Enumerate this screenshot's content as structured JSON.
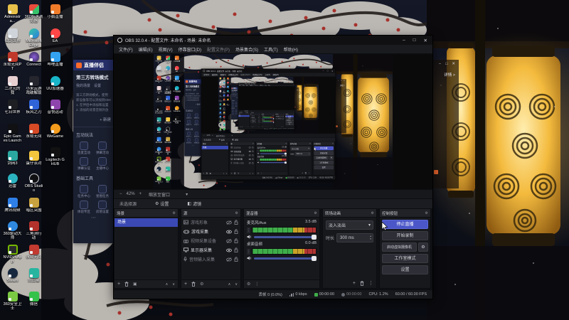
{
  "ui_colors": {
    "accent": "#4b57c8",
    "selection": "#3a49b4",
    "stream_green": "#3fae4a",
    "meter_green": "#3fae4a",
    "meter_yellow": "#c9a227",
    "meter_red": "#b03434",
    "lantern": "#f7c948",
    "companion_header": "#27306b"
  },
  "icons": {
    "gear": "⚙",
    "kebab": "⋮",
    "up": "∧",
    "down": "∨",
    "caret": "▾",
    "plus": "+",
    "minus": "−",
    "spin_up": "▴",
    "spin_down": "▾",
    "grip": "⋮",
    "more": "⋯",
    "filter": "◧",
    "dup": "▣"
  },
  "window_controls": {
    "minimize": "–",
    "maximize": "□",
    "close": "✕"
  },
  "desktop": {
    "icons": [
      {
        "label": "Administra..."
      },
      {
        "label": "仙剑世界"
      },
      {
        "label": "永劫无间PT"
      },
      {
        "label": "二次元的我"
      },
      {
        "label": "七日世界"
      },
      {
        "label": "Epic Games Launcher"
      },
      {
        "label": "剑网3"
      },
      {
        "label": "迅雷"
      },
      {
        "label": "腾讯视频"
      },
      {
        "label": "360驱动大师"
      },
      {
        "label": "NVIDIA App"
      },
      {
        "label": "Steam"
      },
      {
        "label": "360安全卫士"
      },
      {
        "label": "360极速浏览器"
      },
      {
        "label": "Microsoft Edge"
      },
      {
        "label": "Connect"
      },
      {
        "label": "小米云游戏破解版"
      },
      {
        "label": "疾风之刃"
      },
      {
        "label": "永劫无间"
      },
      {
        "label": "蛋仔派对"
      },
      {
        "label": "OBS Studio"
      },
      {
        "label": "暗区突围"
      },
      {
        "label": "三角洲行动"
      },
      {
        "label": "永劫无间"
      },
      {
        "label": "向日葵"
      },
      {
        "label": "微信"
      },
      {
        "label": "小鹅直播"
      },
      {
        "label": "EA"
      },
      {
        "label": "哔哩直播"
      },
      {
        "label": "UU加速器"
      },
      {
        "label": "音悦运动"
      },
      {
        "label": "WeGame"
      },
      {
        "label": "Logitech G HUB"
      }
    ]
  },
  "companion": {
    "logo": "直播伴侣",
    "heading": "第三方转场模式",
    "tabs": "我的场景　设置",
    "desc1": "第三方转场模式，使用",
    "desc2": "新设备等可以添加到OBS",
    "desc3": "1. 在伴侣中添加和设置",
    "desc4": "2. 添加的背景音频外放",
    "new_button": "+ 新建",
    "section_interact": "互动玩法",
    "interact_items": [
      {
        "label": "连麦互动"
      },
      {
        "label": "弹幕活动"
      },
      {
        "label": "弹幕认证"
      },
      {
        "label": "主播中心"
      }
    ],
    "section_tools": "基础工具",
    "tool_items": [
      {
        "label": "任务中心"
      },
      {
        "label": "星图任务"
      },
      {
        "label": "体验专区"
      },
      {
        "label": "房管设置"
      }
    ],
    "more": "⋯",
    "detail_link": "详情 >"
  },
  "obs": {
    "title": "OBS 32.0.4 - 配置文件: 未命名 - 场景: 未命名",
    "menu": [
      {
        "label": "文件(F)"
      },
      {
        "label": "编辑(E)"
      },
      {
        "label": "视图(V)"
      },
      {
        "label": "停靠窗口(D)"
      },
      {
        "label": "配置文件(P)"
      },
      {
        "label": "场景集合(S)"
      },
      {
        "label": "工具(T)"
      },
      {
        "label": "帮助(H)"
      }
    ],
    "zoom": {
      "level": "42%",
      "fit": "缩放至窗口"
    },
    "source_bar": {
      "none_selected": "未选择源",
      "settings": "设置",
      "filters": "滤镜"
    },
    "scenes": {
      "title": "场景",
      "items": [
        {
          "name": "场景"
        }
      ]
    },
    "sources": {
      "title": "源",
      "items": [
        {
          "name": "游戏形象",
          "visible": false
        },
        {
          "name": "游戏采集",
          "visible": true
        },
        {
          "name": "视频采集设备",
          "visible": false
        },
        {
          "name": "显示器采集",
          "visible": true
        },
        {
          "name": "音频输入采集",
          "visible": false
        }
      ]
    },
    "mixer": {
      "title": "混音器",
      "channels": [
        {
          "name": "麦克风/Aux",
          "db": "3.5 dB"
        },
        {
          "name": "桌面音频",
          "db": "0.0 dB"
        }
      ]
    },
    "transitions": {
      "title": "转场动画",
      "selected": "淡入淡出",
      "duration_label": "时长",
      "duration": "300 ms"
    },
    "controls": {
      "title": "控制按钮",
      "stop_stream": "停止直播",
      "start_record": "开始录制",
      "virtual_cam": "启动虚拟摄像机",
      "studio_mode": "工作室模式",
      "settings": "设置"
    },
    "status": {
      "dropped": "丢帧 0 (0.0%)",
      "bitrate": "0 kbps",
      "stream_time": "00:00:00",
      "rec_time": "00:00:00",
      "cpu": "CPU: 1.2%",
      "fps": "60.00 / 60.00 FPS"
    }
  }
}
